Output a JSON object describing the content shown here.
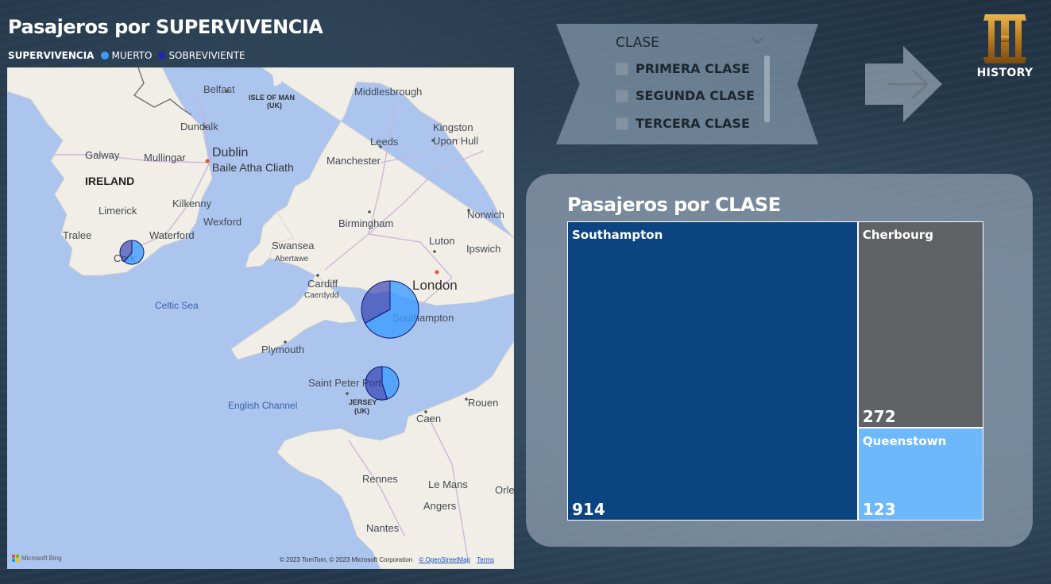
{
  "map_visual": {
    "title": "Pasajeros por SUPERVIVENCIA",
    "legend": {
      "title": "SUPERVIVENCIA",
      "items": [
        {
          "label": "MUERTO",
          "color": "#3d9bff"
        },
        {
          "label": "SOBREVIVIENTE",
          "color": "#1f2aa8"
        }
      ]
    },
    "places": {
      "belfast": "Belfast",
      "isle_of_man": "ISLE OF MAN",
      "isle_of_man_uk": "(UK)",
      "middlesbrough": "Middlesbrough",
      "dundalk": "Dundalk",
      "kingston": "Kingston",
      "upon_hull": "Upon Hull",
      "leeds": "Leeds",
      "galway": "Galway",
      "mullingar": "Mullingar",
      "dublin": "Dublin",
      "baile_atha_cliath": "Baile Atha Cliath",
      "manchester": "Manchester",
      "ireland": "IRELAND",
      "kilkenny": "Kilkenny",
      "limerick": "Limerick",
      "wexford": "Wexford",
      "birmingham": "Birmingham",
      "norwich": "Norwich",
      "tralee": "Tralee",
      "waterford": "Waterford",
      "swansea": "Swansea",
      "abertawe": "Abertawe",
      "luton": "Luton",
      "ipswich": "Ipswich",
      "cork": "Cork",
      "cardiff": "Cardiff",
      "caerdydd": "Caerdydd",
      "london": "London",
      "celtic_sea": "Celtic Sea",
      "southampton": "Southampton",
      "plymouth": "Plymouth",
      "saint_peter_port": "Saint Peter Port",
      "jersey": "JERSEY",
      "jersey_uk": "(UK)",
      "english_channel": "English Channel",
      "rouen": "Rouen",
      "caen": "Caen",
      "rennes": "Rennes",
      "le_mans": "Le Mans",
      "angers": "Angers",
      "nantes": "Nantes",
      "orleans": "Orle"
    },
    "pies": [
      {
        "port": "Cork",
        "muerto_fraction": 0.61,
        "sobreviviente_fraction": 0.39
      },
      {
        "port": "Southampton",
        "muerto_fraction": 0.67,
        "sobreviviente_fraction": 0.33
      },
      {
        "port": "Cherbourg",
        "muerto_fraction": 0.45,
        "sobreviviente_fraction": 0.55
      }
    ],
    "attribution": "© 2023 TomTom, © 2023 Microsoft Corporation",
    "attribution_osm": "© OpenStreetMap",
    "attribution_terms": "Terms",
    "bing": "Microsoft Bing"
  },
  "slicer": {
    "title": "CLASE",
    "options": [
      "PRIMERA CLASE",
      "SEGUNDA CLASE",
      "TERCERA CLASE"
    ]
  },
  "logo": {
    "text": "HISTORY"
  },
  "treemap": {
    "title": "Pasajeros por CLASE",
    "colors": {
      "Southampton": "#0b4480",
      "Cherbourg": "#606366",
      "Queenstown": "#6cb8fa"
    }
  },
  "chart_data": {
    "type": "treemap",
    "title": "Pasajeros por CLASE",
    "categories": [
      "Southampton",
      "Cherbourg",
      "Queenstown"
    ],
    "values": [
      914,
      272,
      123
    ]
  }
}
